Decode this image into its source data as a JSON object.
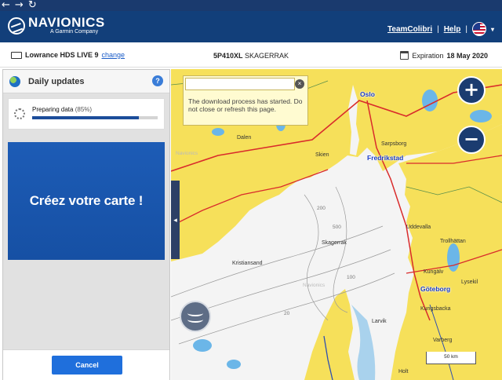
{
  "browser": {
    "back_glyph": "←",
    "forward_glyph": "→",
    "reload_glyph": "↻"
  },
  "header": {
    "logo_title": "NAVIONICS",
    "logo_subtitle": "A Garmin Company",
    "user_link": "TeamColibri",
    "separator": "|",
    "help_link": "Help",
    "language_caret": "▾"
  },
  "subbar": {
    "device_name": "Lowrance HDS LIVE 9",
    "device_change_link": "change",
    "chart_code": "5P410XL",
    "chart_region": "SKAGERRAK",
    "expiration_label": "Expiration",
    "expiration_date": "18 May 2020"
  },
  "panel": {
    "title": "Daily updates",
    "help_glyph": "?",
    "progress_label": "Preparing data",
    "progress_pct_text": "(85%)",
    "progress_value": 0.85,
    "promo_text": "Créez votre carte !",
    "cancel_label": "Cancel",
    "collapse_glyph": "◂"
  },
  "map": {
    "tooltip_text": "The download process has started. Do not close or refresh this page.",
    "tooltip_close_glyph": "×",
    "zoom_in_glyph": "+",
    "zoom_out_glyph": "−",
    "scale_text": "50 km",
    "cities": [
      "Oslo",
      "Fredrikstad",
      "Göteborg"
    ],
    "towns": [
      "Sarpsborg",
      "Skien",
      "Uddevalla",
      "Trollhättan",
      "Kungälv",
      "Lysekil",
      "Kristiansand",
      "Varberg",
      "Kungsbacka",
      "Holt",
      "Larvik",
      "Dalen",
      "Skagerrak"
    ],
    "depths": [
      "500",
      "100",
      "20",
      "200"
    ],
    "watermarks": [
      "Navionics",
      "Navionics"
    ],
    "colors": {
      "land": "#f6e05a",
      "water": "#f4f4f4",
      "shallow": "#6bb6e8",
      "roads": "#d92b2b",
      "header": "#123f7a",
      "accent": "#1f6fdc"
    }
  }
}
